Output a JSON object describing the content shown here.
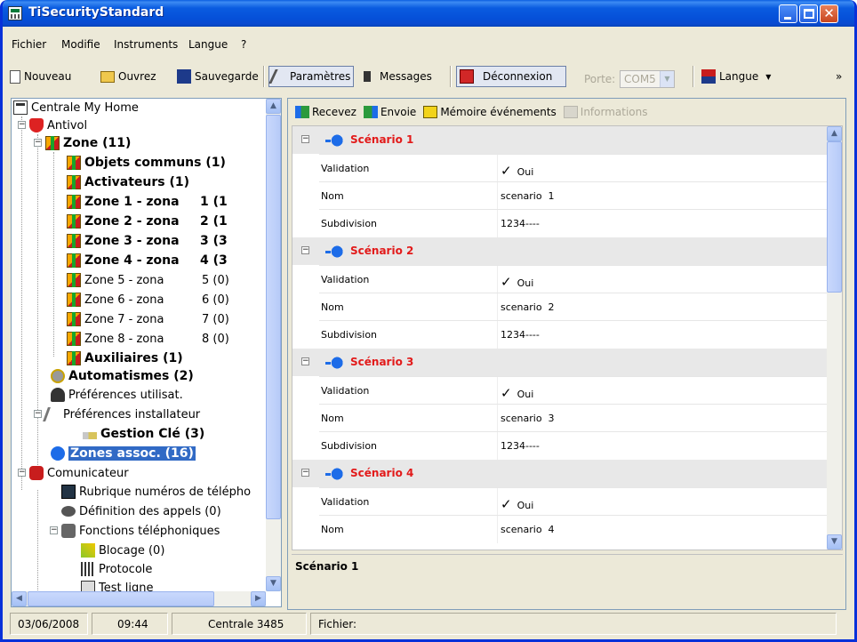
{
  "window": {
    "title": "TiSecurityStandard"
  },
  "menu": [
    "Fichier",
    "Modifie",
    "Instruments",
    "Langue",
    "?"
  ],
  "toolbar": {
    "new": "Nouveau",
    "open": "Ouvrez",
    "save": "Sauvegarde",
    "params": "Paramètres",
    "messages": "Messages",
    "disconnect": "Déconnexion",
    "port_label": "Porte:",
    "port_value": "COM5",
    "language": "Langue",
    "overflow": "»"
  },
  "tree": {
    "root": "Centrale My Home",
    "antivol": "Antivol",
    "zone_group": "Zone (11)",
    "objets_communs": "Objets communs (1)",
    "activateurs": "Activateurs (1)",
    "zones": [
      {
        "name": "Zone 1 - zona",
        "count": "1 (1",
        "bold": true
      },
      {
        "name": "Zone 2 - zona",
        "count": "2 (1",
        "bold": true
      },
      {
        "name": "Zone 3 - zona",
        "count": "3 (3",
        "bold": true
      },
      {
        "name": "Zone 4 - zona",
        "count": "4 (3",
        "bold": true
      },
      {
        "name": "Zone 5 - zona",
        "count": "5 (0)",
        "bold": false
      },
      {
        "name": "Zone 6 - zona",
        "count": "6 (0)",
        "bold": false
      },
      {
        "name": "Zone 7 - zona",
        "count": "7 (0)",
        "bold": false
      },
      {
        "name": "Zone 8 - zona",
        "count": "8 (0)",
        "bold": false
      }
    ],
    "auxiliaires": "Auxiliaires (1)",
    "automatismes": "Automatismes (2)",
    "pref_util": "Préférences utilisat.",
    "pref_install": "Préférences installateur",
    "gestion_cle": "Gestion Clé (3)",
    "zones_assoc": "Zones assoc. (16)",
    "comunicateur": "Comunicateur",
    "rubrique": "Rubrique numéros de télépho",
    "definition": "Définition des appels (0)",
    "fonctions": "Fonctions téléphoniques",
    "blocage": "Blocage (0)",
    "protocole": "Protocole",
    "test": "Test ligne"
  },
  "right_toolbar": {
    "receive": "Recevez",
    "send": "Envoie",
    "memory": "Mémoire événements",
    "info": "Informations"
  },
  "scenarios": [
    {
      "title": "Scénario 1",
      "validation_label": "Validation",
      "validation_value": "Oui",
      "name_label": "Nom",
      "name_value": "scenario  1",
      "subdiv_label": "Subdivision",
      "subdiv_value": "1234----"
    },
    {
      "title": "Scénario 2",
      "validation_label": "Validation",
      "validation_value": "Oui",
      "name_label": "Nom",
      "name_value": "scenario  2",
      "subdiv_label": "Subdivision",
      "subdiv_value": "1234----"
    },
    {
      "title": "Scénario 3",
      "validation_label": "Validation",
      "validation_value": "Oui",
      "name_label": "Nom",
      "name_value": "scenario  3",
      "subdiv_label": "Subdivision",
      "subdiv_value": "1234----"
    },
    {
      "title": "Scénario 4",
      "validation_label": "Validation",
      "validation_value": "Oui",
      "name_label": "Nom",
      "name_value": "scenario  4"
    }
  ],
  "description": {
    "title": "Scénario 1"
  },
  "status": {
    "date": "03/06/2008",
    "time": "09:44",
    "central": "Centrale 3485",
    "file": "Fichier:"
  },
  "colors": {
    "titlebar": "#0a5ce0",
    "scenario_title": "#e21a1a",
    "selection": "#316ac5"
  }
}
